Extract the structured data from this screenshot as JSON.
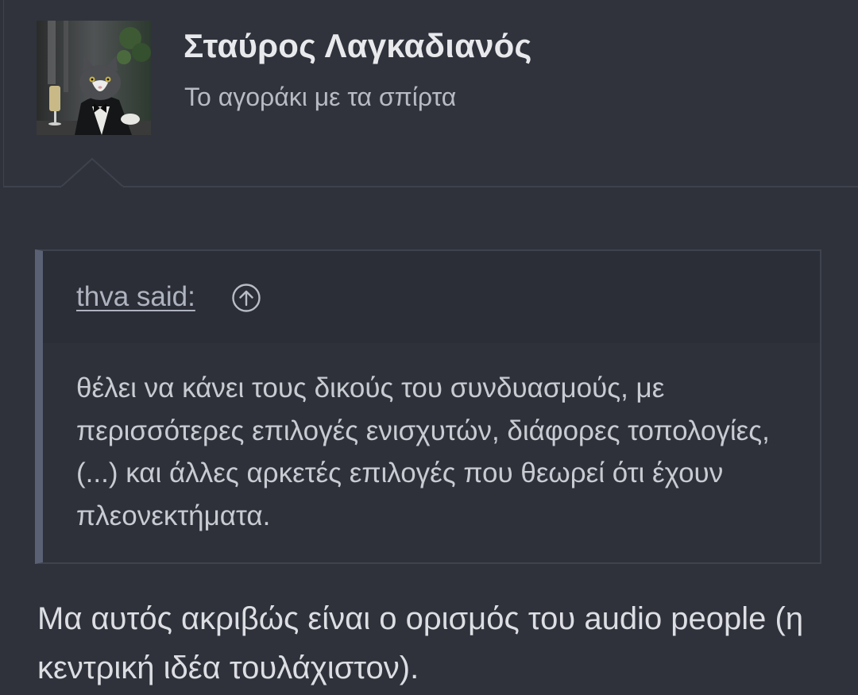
{
  "post": {
    "user": {
      "name": "Σταύρος Λαγκαδιανός",
      "title": "Το αγοράκι με τα σπίρτα"
    },
    "quote": {
      "author_link": "thva said:",
      "body": "θέλει να κάνει τους δικούς του συνδυασμούς, με περισσότερες επιλογές ενισχυτών, διάφορες τοπολογίες, (...) και άλλες αρκετές επιλογές που θεωρεί ότι έχουν πλεονεκτήματα."
    },
    "message": "Μα αυτός ακριβώς είναι ο ορισμός του audio people (η κεντρική ιδέα τουλάχιστον)."
  },
  "colors": {
    "background": "#2f323b",
    "quote_accent": "#5a6175",
    "text_primary": "#dcdee3",
    "text_secondary": "#b8bbc3"
  },
  "icons": {
    "jump_to_quote": "arrow-up-circle-icon",
    "avatar": "cat-in-tuxedo-avatar"
  }
}
